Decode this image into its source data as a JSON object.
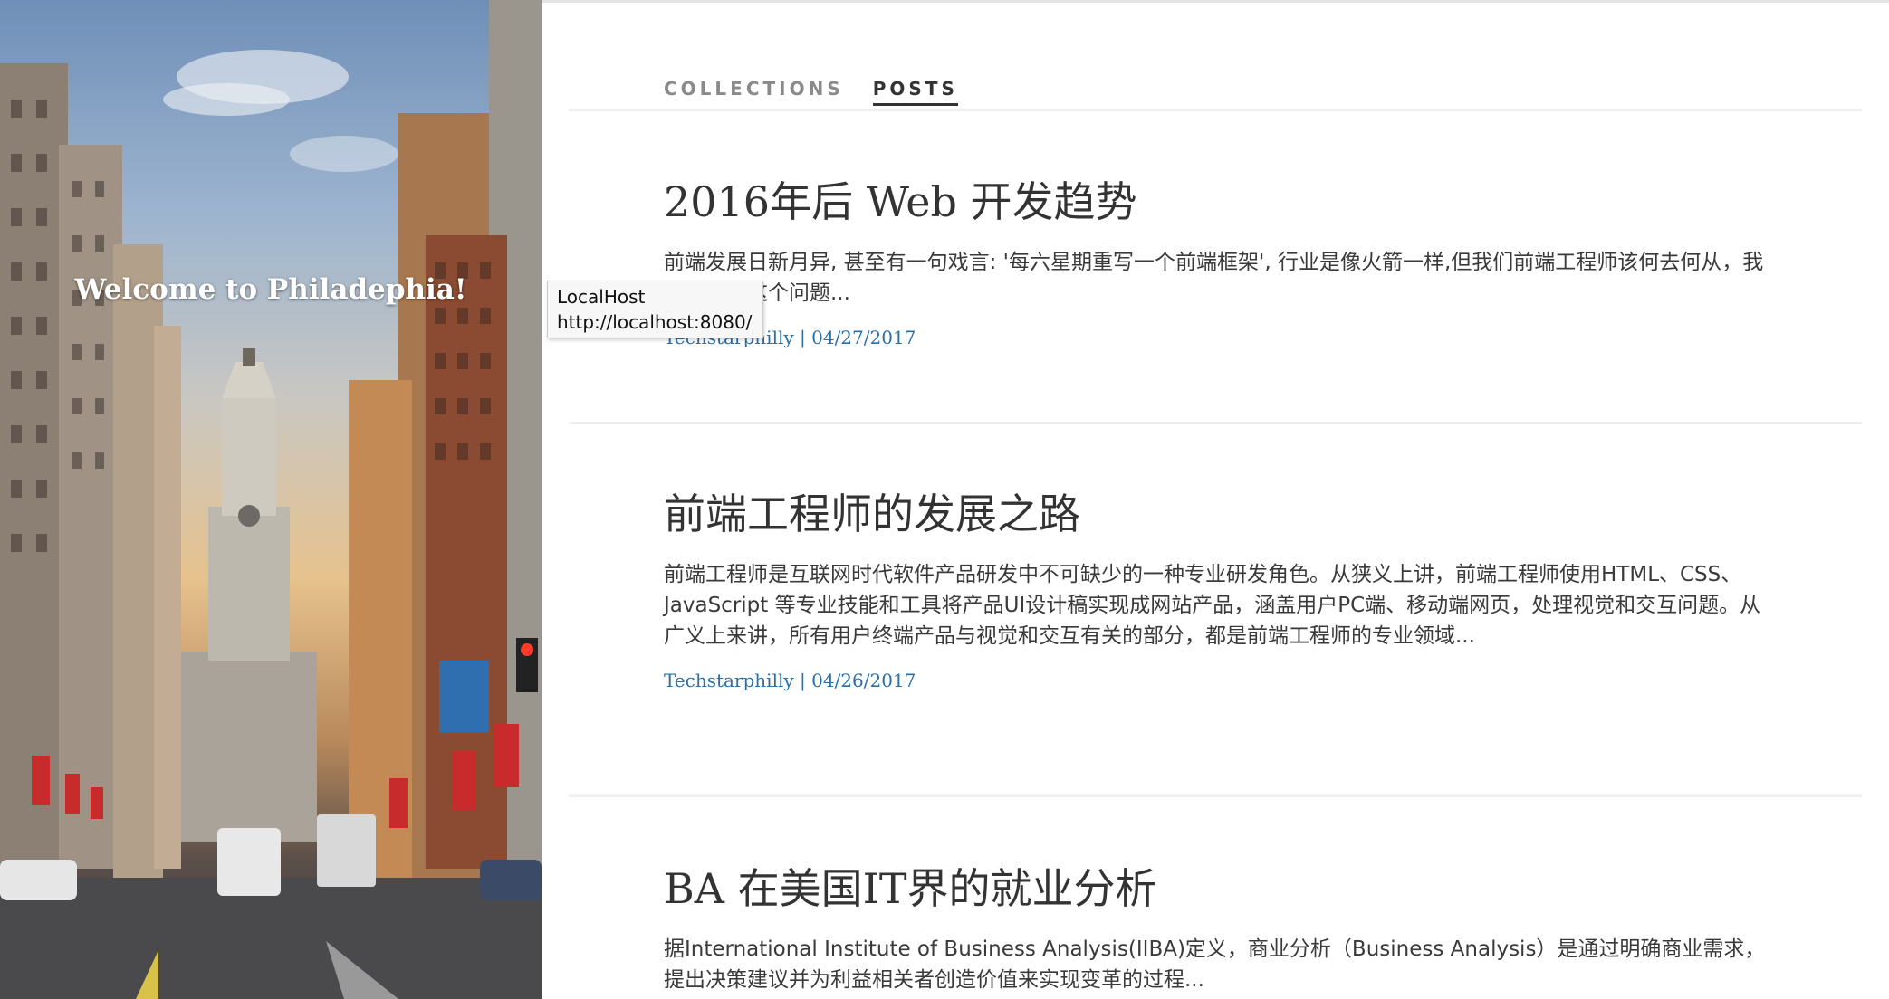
{
  "hero": {
    "title": "Welcome to Philadephia!"
  },
  "tabs": [
    {
      "label": "COLLECTIONS",
      "active": false
    },
    {
      "label": "POSTS",
      "active": true
    }
  ],
  "posts": [
    {
      "title": "2016年后 Web 开发趋势",
      "excerpt": "前端发展日新月异, 甚至有一句戏言: '每六星期重写一个前端框架', 行业是像火箭一样,但我们前端工程师该何去何从，我们来谈谈这个问题...",
      "meta": "Techstarphilly | 04/27/2017"
    },
    {
      "title": "前端工程师的发展之路",
      "excerpt": "前端工程师是互联网时代软件产品研发中不可缺少的一种专业研发角色。从狭义上讲，前端工程师使用HTML、CSS、JavaScript 等专业技能和工具将产品UI设计稿实现成网站产品，涵盖用户PC端、移动端网页，处理视觉和交互问题。从广义上来讲，所有用户终端产品与视觉和交互有关的部分，都是前端工程师的专业领域...",
      "meta": "Techstarphilly | 04/26/2017"
    },
    {
      "title": "BA 在美国IT界的就业分析",
      "excerpt": "据International Institute of Business Analysis(IIBA)定义，商业分析（Business Analysis）是通过明确商业需求，提出决策建议并为利益相关者创造价值来实现变革的过程...",
      "meta": ""
    }
  ],
  "tooltip": {
    "line1": "LocalHost",
    "line2": "http://localhost:8080/"
  },
  "colors": {
    "link": "#2a6fa6",
    "text": "#333333",
    "tab_inactive": "#8a8a8a"
  }
}
